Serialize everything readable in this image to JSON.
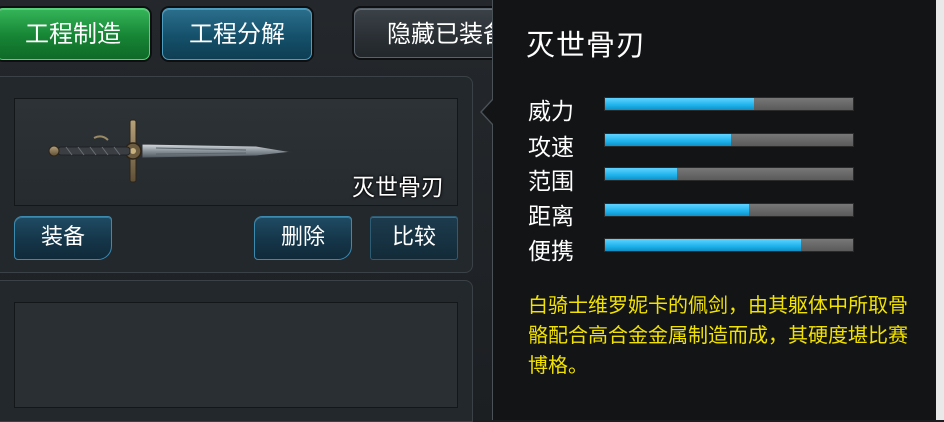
{
  "top_buttons": {
    "craft": "工程制造",
    "dismantle": "工程分解",
    "hide_equipped": "隐藏已装备"
  },
  "item": {
    "name": "灭世骨刃",
    "icon": "sword-icon",
    "equip_label": "装备",
    "delete_label": "删除",
    "compare_label": "比较"
  },
  "tooltip": {
    "title": "灭世骨刃",
    "stats": [
      {
        "label": "威力",
        "value": 0.6
      },
      {
        "label": "攻速",
        "value": 0.51
      },
      {
        "label": "范围",
        "value": 0.29
      },
      {
        "label": "距离",
        "value": 0.58
      },
      {
        "label": "便携",
        "value": 0.79
      }
    ],
    "description": "白骑士维罗妮卡的佩剑，由其躯体中所取骨骼配合高合金金属制造而成，其硬度堪比赛博格。"
  },
  "colors": {
    "bar_fill": "#1fb2ec",
    "bar_track": "#6a6a6a",
    "description_text": "#f2e200",
    "craft_button": "#168434",
    "dismantle_button": "#15506a"
  }
}
